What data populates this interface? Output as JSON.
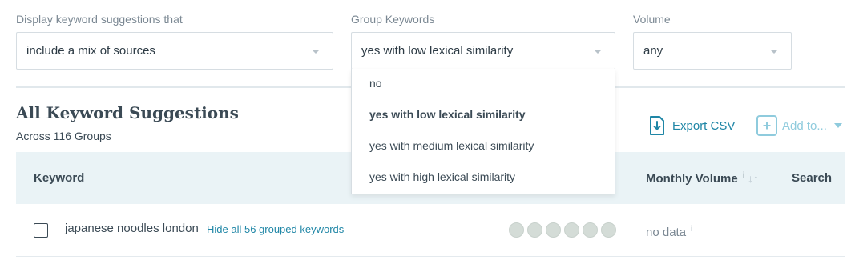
{
  "filters": {
    "source": {
      "label": "Display keyword suggestions that",
      "value": "include a mix of sources"
    },
    "group": {
      "label": "Group Keywords",
      "value": "yes with low lexical similarity",
      "options": [
        "no",
        "yes with low lexical similarity",
        "yes with medium lexical similarity",
        "yes with high lexical similarity"
      ]
    },
    "volume": {
      "label": "Volume",
      "value": "any"
    }
  },
  "section": {
    "title": "All Keyword Suggestions",
    "subtitle": "Across 116 Groups"
  },
  "actions": {
    "export_label": "Export CSV",
    "add_label": "Add to..."
  },
  "table": {
    "columns": {
      "keyword": "Keyword",
      "monthly_volume": "Monthly Volume",
      "info": "i",
      "search": "Search"
    },
    "rows": [
      {
        "keyword": "japanese noodles london",
        "group_link": "Hide all 56 grouped keywords",
        "volume": "no data",
        "info": "i"
      }
    ]
  },
  "colors": {
    "accent": "#1f86a6",
    "accent_light": "#8fcbdd",
    "header_bg": "#eaf3f6"
  }
}
